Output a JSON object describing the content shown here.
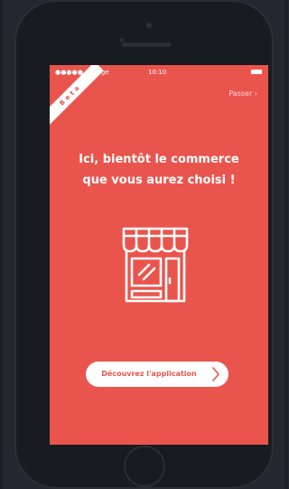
{
  "status_bar": {
    "carrier": "●●●●● Orange",
    "time": "10:10"
  },
  "onboarding": {
    "skip_label": "Passer ›",
    "beta_label": "Beta",
    "headline_line1": "Ici, bientôt le commerce",
    "headline_line2": "que vous aurez choisi !",
    "cta_label": "Découvrez l'application",
    "illustration": "storefront-icon",
    "cta_arrow": "chevron-right-icon"
  },
  "colors": {
    "screen_background": "#e9554d",
    "device_body": "#1a1d23",
    "page_background": "#232830",
    "cta_background": "#ffffff",
    "cta_text": "#e9554d"
  }
}
